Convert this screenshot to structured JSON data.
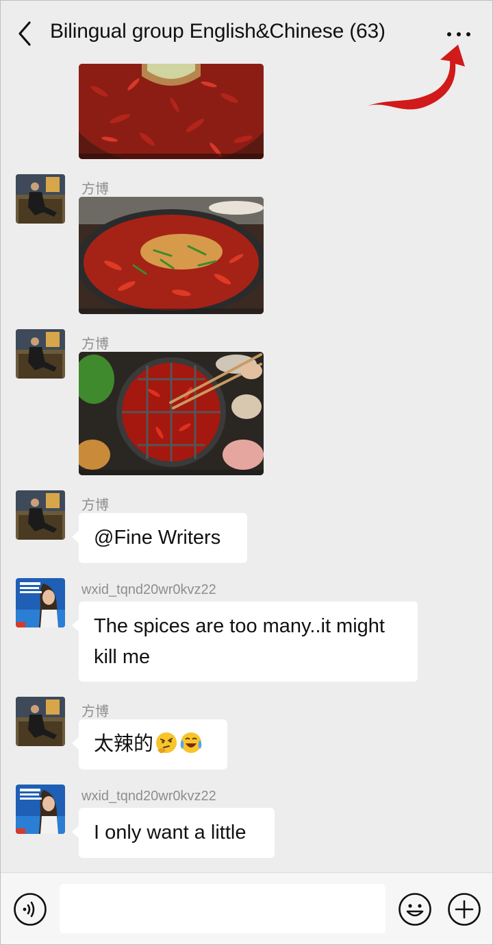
{
  "header": {
    "title": "Bilingual group English&Chinese (63)"
  },
  "colors": {
    "background": "#ededed",
    "bubble": "#ffffff",
    "annotation_arrow": "#d11a1a"
  },
  "messages": [
    {
      "type": "image",
      "content": "hotpot-photo-partial"
    },
    {
      "type": "image",
      "sender": "方博",
      "content": "hotpot-photo"
    },
    {
      "type": "image",
      "sender": "方博",
      "content": "hotpot-with-chopsticks-photo"
    },
    {
      "type": "text",
      "sender": "方博",
      "text": "@Fine Writers"
    },
    {
      "type": "text",
      "sender": "wxid_tqnd20wr0kvz22",
      "text_line1": "The spices are too many..it might",
      "text_line2": "kill me"
    },
    {
      "type": "text",
      "sender": "方博",
      "text": "太辣的",
      "emojis": [
        "thinking-face-emoji",
        "rolling-laughing-emoji"
      ]
    },
    {
      "type": "text",
      "sender": "wxid_tqnd20wr0kvz22",
      "text": "I only want a little"
    }
  ],
  "input_bar": {
    "value": "",
    "icons": [
      "voice-icon",
      "emoji-icon",
      "plus-icon"
    ]
  }
}
